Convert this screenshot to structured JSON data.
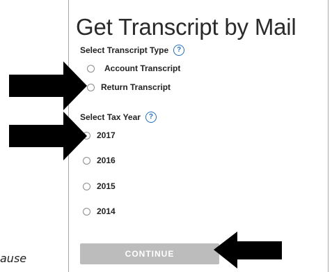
{
  "panel": {
    "title": "Get Transcript by Mail",
    "transcript_type": {
      "label": "Select Transcript Type",
      "options": [
        "Account Transcript",
        "Return Transcript"
      ]
    },
    "tax_year": {
      "label": "Select Tax Year",
      "options": [
        "2017",
        "2016",
        "2015",
        "2014"
      ]
    },
    "help_icon_text": "?",
    "continue_label": "CONTINUE"
  },
  "caption": "ause",
  "colors": {
    "help_icon": "#1f6fb8",
    "continue_bg": "#bcbcbc",
    "arrow": "#000000"
  },
  "icons": [
    "help-icon",
    "arrow-icon"
  ]
}
